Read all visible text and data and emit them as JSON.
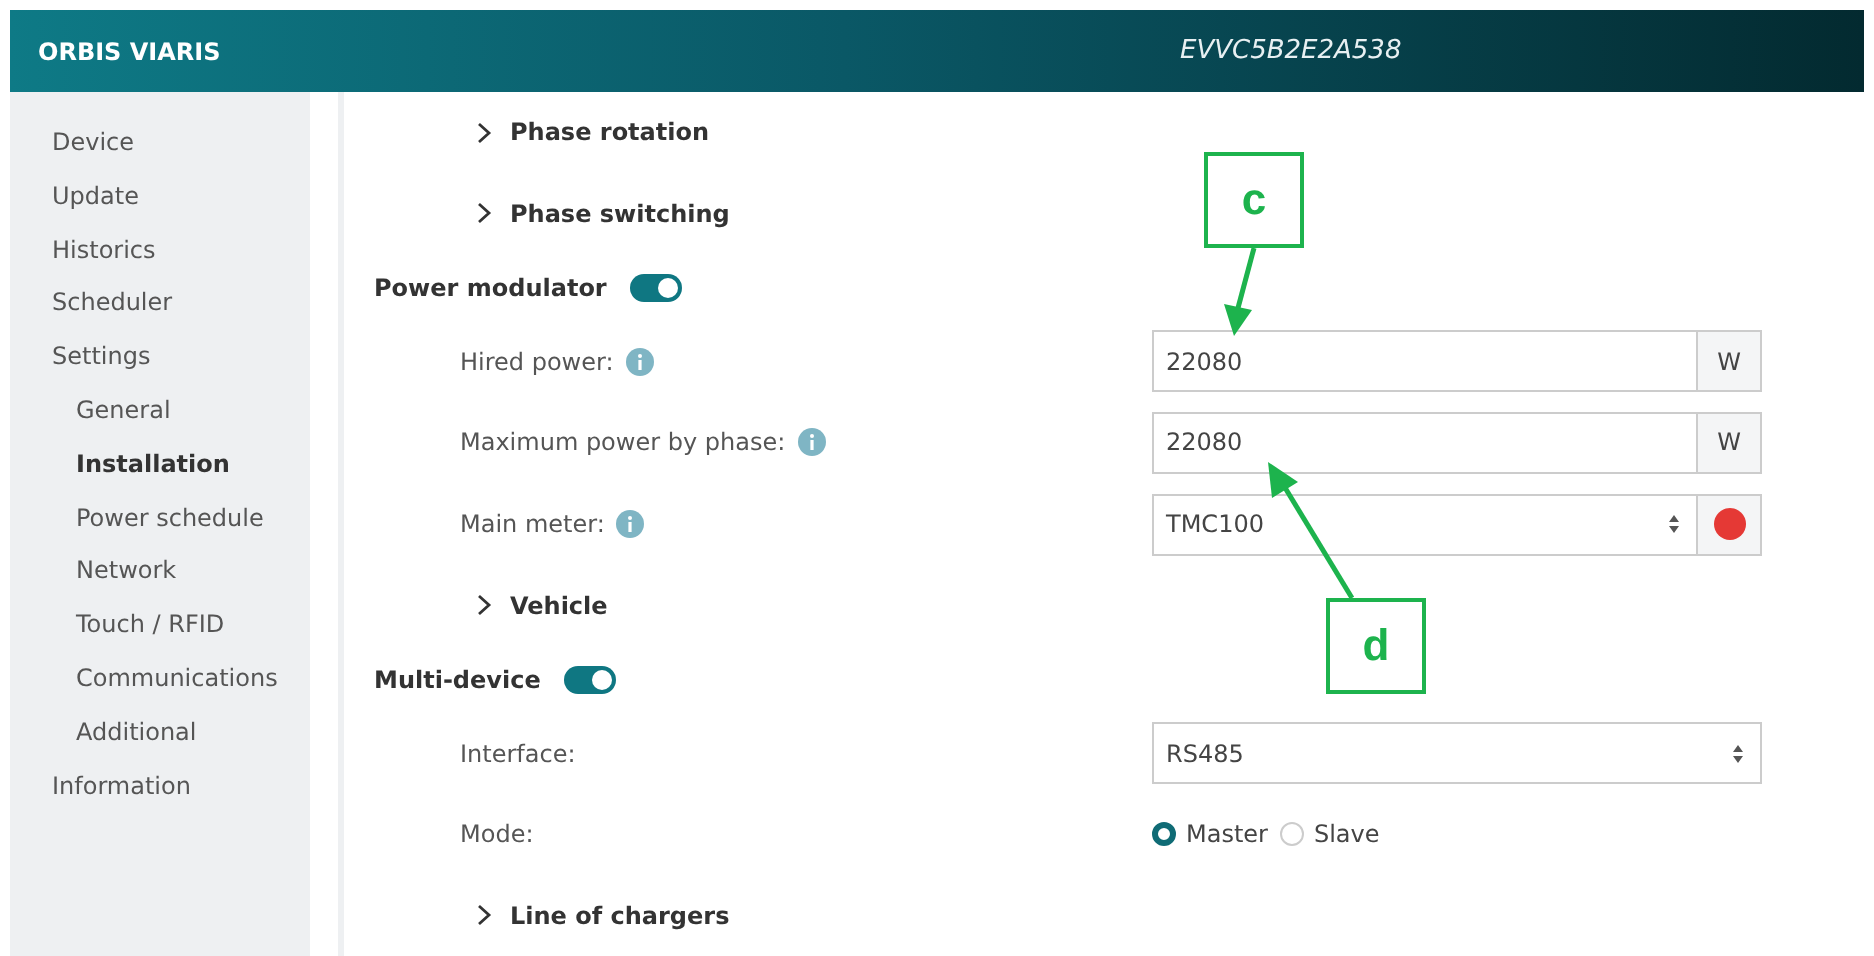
{
  "header": {
    "brand": "ORBIS VIARIS",
    "device_id": "EVVC5B2E2A538"
  },
  "sidebar": {
    "items": [
      {
        "label": "Device",
        "selected": false
      },
      {
        "label": "Update",
        "selected": false
      },
      {
        "label": "Historics",
        "selected": false
      },
      {
        "label": "Scheduler",
        "selected": false
      },
      {
        "label": "Settings",
        "selected": false,
        "children": [
          {
            "label": "General",
            "selected": false
          },
          {
            "label": "Installation",
            "selected": true
          },
          {
            "label": "Power schedule",
            "selected": false
          },
          {
            "label": "Network",
            "selected": false
          },
          {
            "label": "Touch / RFID",
            "selected": false
          },
          {
            "label": "Communications",
            "selected": false
          },
          {
            "label": "Additional",
            "selected": false
          }
        ]
      },
      {
        "label": "Information",
        "selected": false
      }
    ]
  },
  "content": {
    "rows": [
      {
        "kind": "expander",
        "label": "Phase rotation",
        "expanded": false
      },
      {
        "kind": "expander",
        "label": "Phase switching",
        "expanded": false
      },
      {
        "kind": "toggle",
        "label": "Power modulator",
        "on": true
      },
      {
        "kind": "input",
        "label": "Hired power:",
        "info": true,
        "value": "22080",
        "unit": "W"
      },
      {
        "kind": "input",
        "label": "Maximum power by phase:",
        "info": true,
        "value": "22080",
        "unit": "W"
      },
      {
        "kind": "select",
        "label": "Main meter:",
        "info": true,
        "value": "TMC100",
        "error": true
      },
      {
        "kind": "expander",
        "label": "Vehicle",
        "expanded": false
      },
      {
        "kind": "toggle",
        "label": "Multi-device",
        "on": true
      },
      {
        "kind": "select",
        "label": "Interface:",
        "value": "RS485"
      },
      {
        "kind": "radio",
        "label": "Mode:",
        "options": [
          {
            "label": "Master",
            "selected": true
          },
          {
            "label": "Slave",
            "selected": false
          }
        ]
      },
      {
        "kind": "expander",
        "label": "Line of chargers",
        "expanded": false
      }
    ]
  },
  "annotations": [
    {
      "label": "c"
    },
    {
      "label": "d"
    }
  ]
}
